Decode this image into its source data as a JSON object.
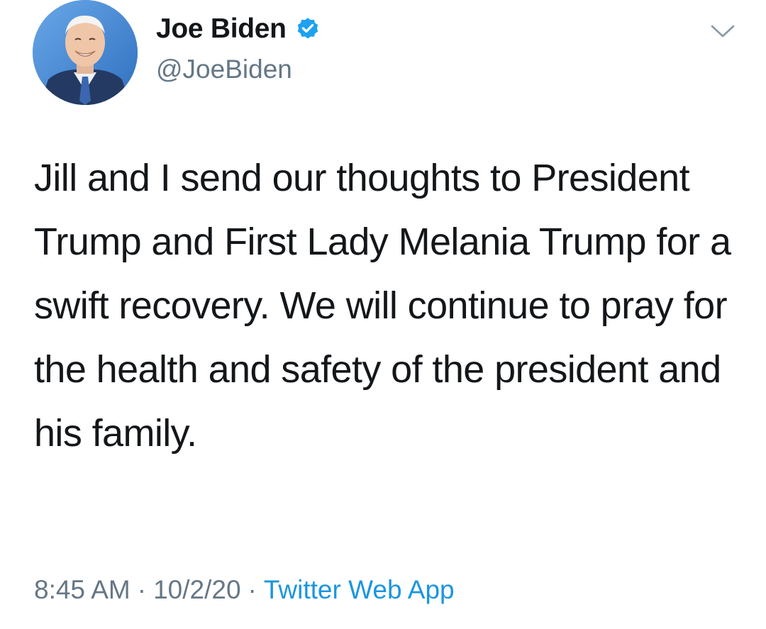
{
  "author": {
    "name": "Joe Biden",
    "handle": "@JoeBiden",
    "verified": true,
    "avatar_icon": "profile-photo"
  },
  "tweet": {
    "text": "Jill and I send our thoughts to President Trump and First Lady Melania Trump for a swift recovery. We will continue to pray for the health and safety of the president and his family.",
    "time": "8:45 AM",
    "date": "10/2/20",
    "separator": "·",
    "source": "Twitter Web App"
  },
  "icons": {
    "verified": "verified-badge-icon",
    "more": "chevron-down-icon"
  },
  "colors": {
    "text": "#14171a",
    "secondary": "#657786",
    "link": "#1b95e0",
    "verified": "#1da1f2"
  }
}
